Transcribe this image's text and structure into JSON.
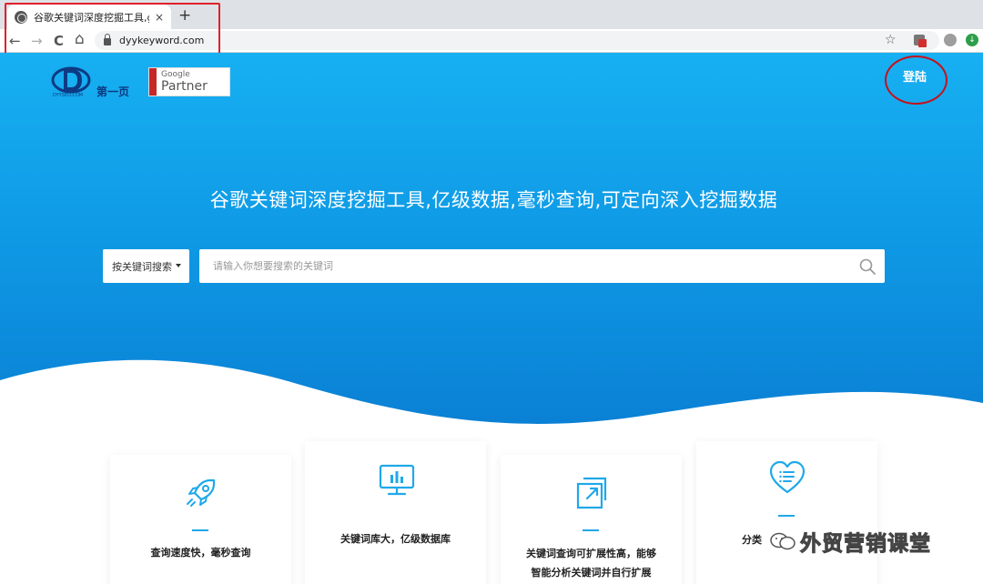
{
  "browser": {
    "tab_title": "谷歌关键词深度挖掘工具,googl",
    "tab_close": "×",
    "new_tab": "+",
    "url": "dyykeyword.com",
    "back": "←",
    "forward": "→",
    "reload": "C",
    "home": "⌂",
    "star": "☆"
  },
  "header": {
    "logo_small": "DYYSEO.COM",
    "logo_text": "第一页",
    "partner_google": "Google",
    "partner_text": "Partner",
    "login_label": "登陆"
  },
  "hero": {
    "title": "谷歌关键词深度挖掘工具,亿级数据,毫秒查询,可定向深入挖掘数据"
  },
  "search": {
    "mode_label": "按关键词搜索",
    "placeholder": "请输入你想要搜索的关键词"
  },
  "features": [
    {
      "icon": "rocket-icon",
      "text": "查询速度快，毫秒查询"
    },
    {
      "icon": "chart-monitor-icon",
      "text": "关键词库大，亿级数据库"
    },
    {
      "icon": "expand-icon",
      "text_line1": "关键词查询可扩展性高，能够",
      "text_line2": "智能分析关键词并自行扩展"
    },
    {
      "icon": "heart-list-icon",
      "text": "分类"
    }
  ],
  "watermark": {
    "text": "外贸营销课堂"
  },
  "colors": {
    "accent": "#1fa8e9",
    "annotation_red": "#e0212b",
    "hero_top": "#17b0f2",
    "hero_bottom": "#0a7fd3"
  }
}
